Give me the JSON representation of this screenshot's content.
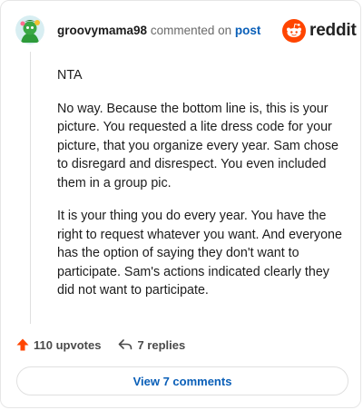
{
  "comment": {
    "username": "groovymama98",
    "action_text": "commented on",
    "target_link": "post",
    "brand_name": "reddit",
    "paragraphs": [
      "NTA",
      "No way. Because the bottom line is, this is your picture. You requested a lite dress code for your picture, that you organize every year. Sam chose to disregard and disrespect. You even included them in a group pic.",
      "It is your thing you do every year. You have the right to request whatever you want. And everyone has the option of saying they don't want to participate. Sam's actions indicated clearly they did not want to participate."
    ],
    "upvotes_label": "110 upvotes",
    "replies_label": "7 replies",
    "view_comments_label": "View 7 comments"
  },
  "colors": {
    "brand_orange": "#ff4500",
    "upvote_orange": "#ff4500",
    "link_blue": "#0a5fb8",
    "avatar_green": "#2e9b3a"
  },
  "icons": {
    "avatar": "avatar-snoo-green",
    "brand": "reddit-snoo-icon",
    "upvote": "upvote-arrow-icon",
    "reply": "reply-arrow-icon"
  }
}
